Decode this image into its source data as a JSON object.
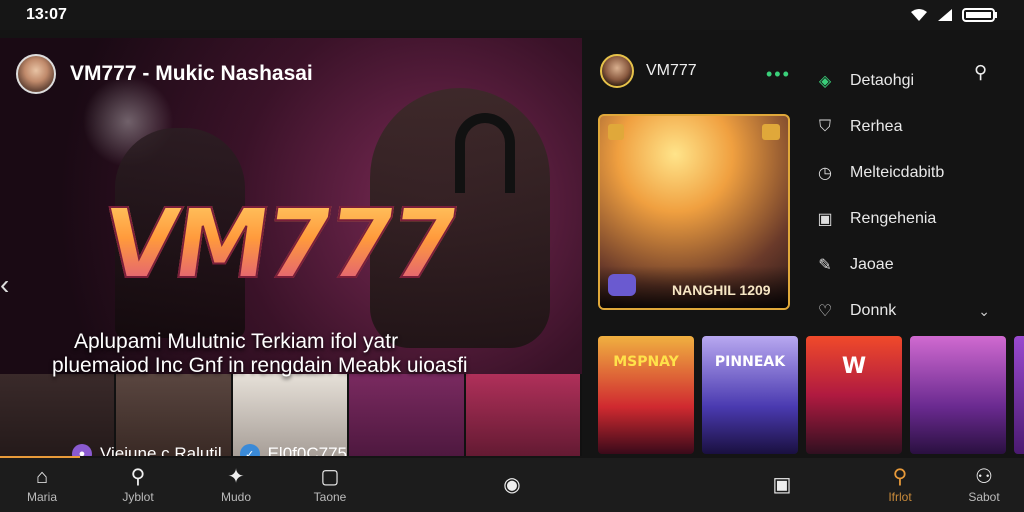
{
  "status": {
    "time": "13:07"
  },
  "hero": {
    "title": "VM777 - Mukic Nashasai",
    "logo": "VM777",
    "caption_line1": "Aplupami Mulutnic Terkiam ifol yatr",
    "caption_line2": "pluemaiod Inc Gnf in rengdain Meabk uioasfi",
    "chip1": "Vieiune c Ralutil",
    "chip2": "El0f0C775"
  },
  "right": {
    "user_name": "VM777",
    "featured_caption": "NANGHIL 1209",
    "menu": [
      {
        "label": "Detaohgi",
        "icon": "diamond-icon"
      },
      {
        "label": "Rerhea",
        "icon": "shield-icon"
      },
      {
        "label": "Melteicdabitb",
        "icon": "clock-icon"
      },
      {
        "label": "Rengehenia",
        "icon": "square-icon"
      },
      {
        "label": "Jaoae",
        "icon": "pen-icon"
      },
      {
        "label": "Donnk",
        "icon": "heart-icon"
      }
    ],
    "cards": [
      {
        "title": "MSPNAY"
      },
      {
        "title": "PINNEAK"
      },
      {
        "title": "W"
      },
      {
        "title": ""
      }
    ]
  },
  "nav": {
    "items": [
      {
        "label": "Maria"
      },
      {
        "label": "Jyblot"
      },
      {
        "label": "Mudo"
      },
      {
        "label": "Taone"
      },
      {
        "label": ""
      },
      {
        "label": ""
      },
      {
        "label": "Ifrlot"
      },
      {
        "label": "Sabot"
      }
    ]
  },
  "colors": {
    "accent": "#e89a3a",
    "green": "#3ad07a"
  }
}
